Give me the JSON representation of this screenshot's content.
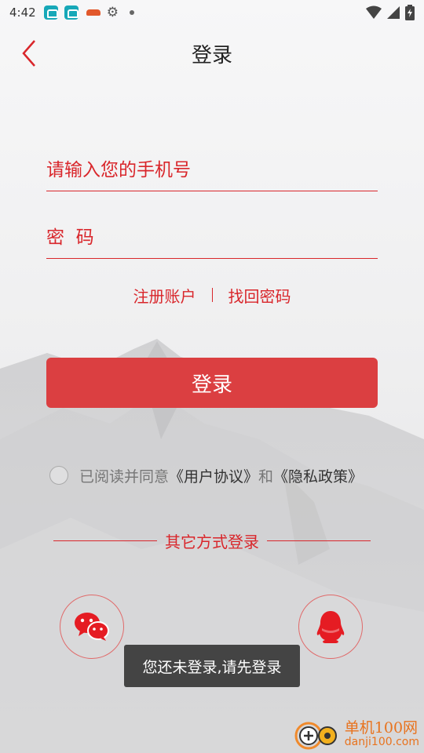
{
  "status_bar": {
    "time": "4:42",
    "icons": [
      "app-icon",
      "app-icon",
      "car-icon",
      "gear-icon",
      "dot-icon",
      "wifi-icon",
      "signal-icon",
      "battery-icon"
    ]
  },
  "header": {
    "title": "登录",
    "back_icon": "chevron-left-icon"
  },
  "form": {
    "phone_placeholder": "请输入您的手机号",
    "password_placeholder": "密  码",
    "register_label": "注册账户",
    "forgot_label": "找回密码",
    "login_button": "登录"
  },
  "agreement": {
    "prefix": "已阅读并同意",
    "user_agreement": "《用户协议》",
    "and": "和",
    "privacy_policy": "《隐私政策》"
  },
  "other_login": {
    "label": "其它方式登录",
    "wechat_icon": "wechat-icon",
    "qq_icon": "qq-icon"
  },
  "toast": {
    "message": "您还未登录,请先登录"
  },
  "watermark": {
    "cn": "单机100网",
    "en": "danji100.com"
  },
  "colors": {
    "accent": "#d9262b",
    "button": "#db3f41",
    "toast_bg": "#444444"
  }
}
